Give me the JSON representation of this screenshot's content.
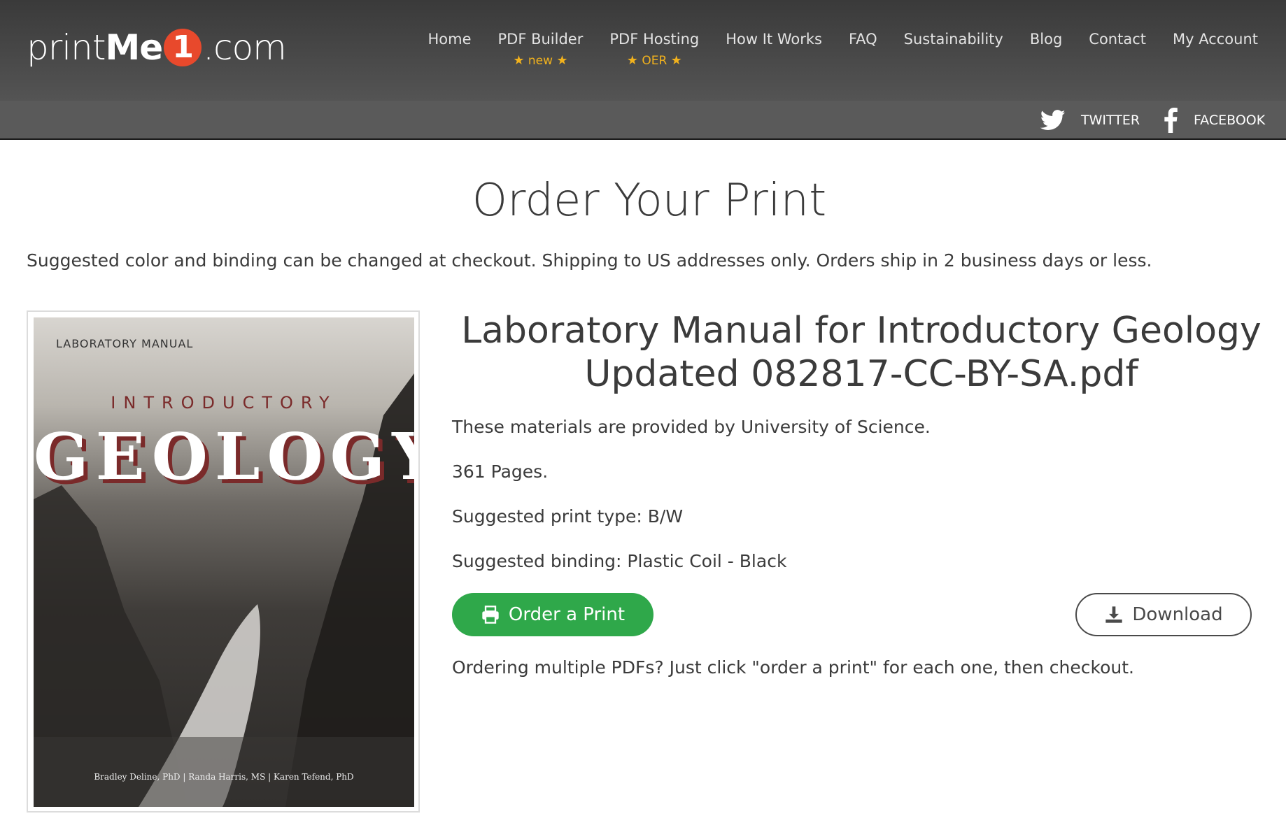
{
  "header": {
    "logo": {
      "part1": "print",
      "part2": "Me",
      "number": "1",
      "part3": ".com"
    },
    "nav": [
      {
        "label": "Home",
        "sub": ""
      },
      {
        "label": "PDF Builder",
        "sub": "new"
      },
      {
        "label": "PDF Hosting",
        "sub": "OER"
      },
      {
        "label": "How It Works",
        "sub": ""
      },
      {
        "label": "FAQ",
        "sub": ""
      },
      {
        "label": "Sustainability",
        "sub": ""
      },
      {
        "label": "Blog",
        "sub": ""
      },
      {
        "label": "Contact",
        "sub": ""
      },
      {
        "label": "My Account",
        "sub": ""
      }
    ],
    "social": {
      "twitter": "TWITTER",
      "facebook": "FACEBOOK"
    }
  },
  "main": {
    "title": "Order Your Print",
    "intro": "Suggested color and binding can be changed at checkout. Shipping to US addresses only. Orders ship in 2 business days or less.",
    "cover": {
      "lab": "LABORATORY MANUAL",
      "intro": "INTRODUCTORY",
      "geology": "GEOLOGY",
      "authors": "Bradley Deline, PhD  |  Randa Harris, MS  |  Karen Tefend, PhD"
    },
    "book": {
      "title_line1": "Laboratory Manual for Introductory Geology",
      "title_line2": "Updated 082817-CC-BY-SA.pdf",
      "provider": "These materials are provided by University of Science.",
      "pages": "361 Pages.",
      "print_type": "Suggested print type: B/W",
      "binding": "Suggested binding: Plastic Coil - Black"
    },
    "buttons": {
      "order": "Order a Print",
      "download": "Download"
    },
    "note": "Ordering multiple PDFs? Just click \"order a print\" for each one, then checkout."
  },
  "colors": {
    "green": "#2fa84a",
    "logo_red": "#e8492c",
    "star": "#f2b21d"
  }
}
